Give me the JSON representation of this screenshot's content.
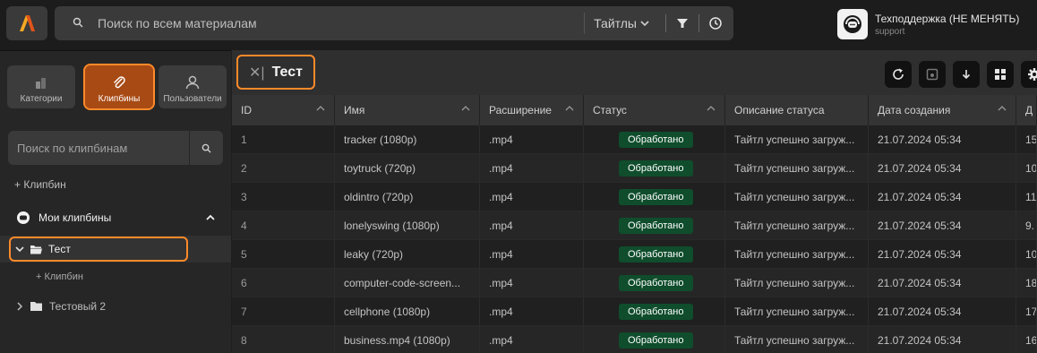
{
  "topbar": {
    "search_placeholder": "Поиск по всем материалам",
    "titles_label": "Тайтлы",
    "user_name": "Техподдержка (НЕ МЕНЯТЬ)",
    "user_sub": "support"
  },
  "sidebar": {
    "tabs": [
      {
        "label": "Категории"
      },
      {
        "label": "Клипбины"
      },
      {
        "label": "Пользователи"
      }
    ],
    "search_placeholder": "Поиск по клипбинам",
    "add_clipbin": "+ Клипбин",
    "my_clipbins": "Мои клипбины",
    "folder_selected": "Тест",
    "sub_add": "+   Клипбин",
    "folder_other": "Тестовый 2"
  },
  "main": {
    "tab_title": "Тест",
    "columns": [
      "ID",
      "Имя",
      "Расширение",
      "Статус",
      "Описание статуса",
      "Дата создания",
      "Д"
    ],
    "rows": [
      {
        "id": "1",
        "name": "tracker (1080p)",
        "ext": ".mp4",
        "status": "Обработано",
        "desc": "Тайтл успешно загруж...",
        "date": "21.07.2024 05:34",
        "more": "15"
      },
      {
        "id": "2",
        "name": "toytruck (720p)",
        "ext": ".mp4",
        "status": "Обработано",
        "desc": "Тайтл успешно загруж...",
        "date": "21.07.2024 05:34",
        "more": "10"
      },
      {
        "id": "3",
        "name": "oldintro (720p)",
        "ext": ".mp4",
        "status": "Обработано",
        "desc": "Тайтл успешно загруж...",
        "date": "21.07.2024 05:34",
        "more": "11"
      },
      {
        "id": "4",
        "name": "lonelyswing (1080p)",
        "ext": ".mp4",
        "status": "Обработано",
        "desc": "Тайтл успешно загруж...",
        "date": "21.07.2024 05:34",
        "more": "9."
      },
      {
        "id": "5",
        "name": "leaky (720p)",
        "ext": ".mp4",
        "status": "Обработано",
        "desc": "Тайтл успешно загруж...",
        "date": "21.07.2024 05:34",
        "more": "10"
      },
      {
        "id": "6",
        "name": "computer-code-screen...",
        "ext": ".mp4",
        "status": "Обработано",
        "desc": "Тайтл успешно загруж...",
        "date": "21.07.2024 05:34",
        "more": "18"
      },
      {
        "id": "7",
        "name": "cellphone (1080p)",
        "ext": ".mp4",
        "status": "Обработано",
        "desc": "Тайтл успешно загруж...",
        "date": "21.07.2024 05:34",
        "more": "17"
      },
      {
        "id": "8",
        "name": "business.mp4 (1080p)",
        "ext": ".mp4",
        "status": "Обработано",
        "desc": "Тайтл успешно загруж...",
        "date": "21.07.2024 05:34",
        "more": "16"
      }
    ]
  },
  "colors": {
    "accent": "#ff8a2a",
    "status_green": "#0f4d2c",
    "logo_orange": "#f28c1b"
  }
}
